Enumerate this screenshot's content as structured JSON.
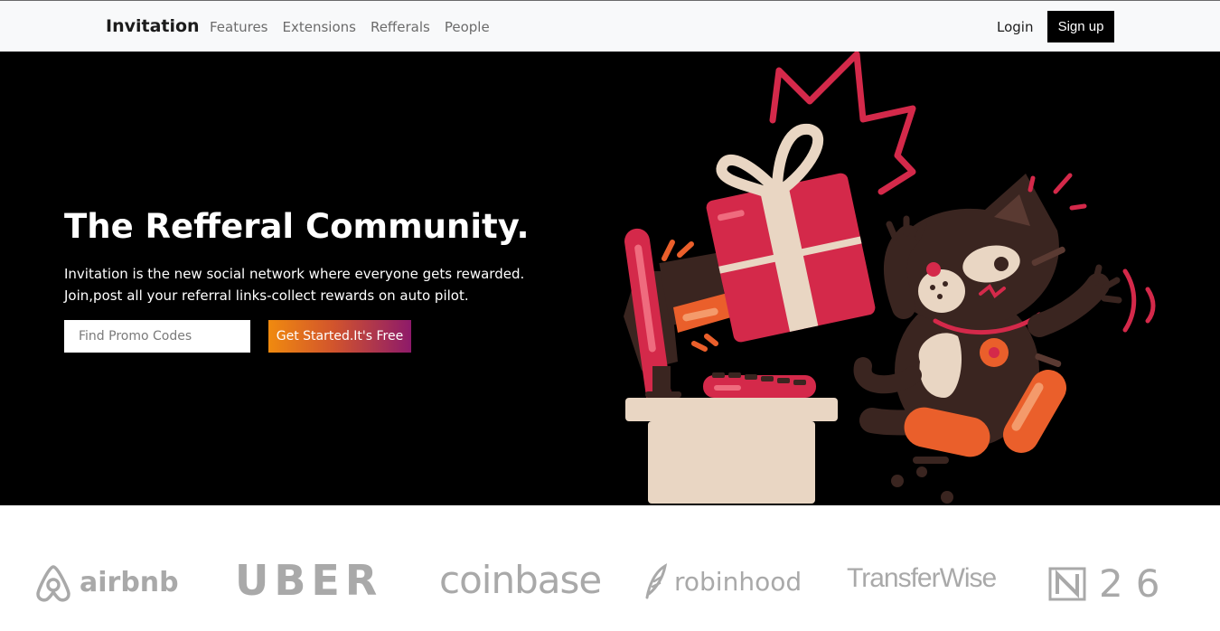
{
  "navbar": {
    "brand": "Invitation",
    "links": [
      "Features",
      "Extensions",
      "Refferals",
      "People"
    ],
    "login": "Login",
    "signup": "Sign up"
  },
  "hero": {
    "title": "The Refferal Community.",
    "lines": [
      "Invitation is the new social network where everyone gets rewarded.",
      "Join,post all your referral links-collect rewards on auto pilot."
    ],
    "search_placeholder": "Find Promo Codes",
    "cta": "Get Started.It's Free"
  },
  "logos": {
    "airbnb": "airbnb",
    "uber": "UBER",
    "coinbase": "coinbase",
    "robinhood": "robinhood",
    "transferwise": "TransferWise",
    "n26_digits": "26"
  },
  "colors": {
    "hero_bg": "#000000",
    "navbar_bg": "#f8f9fa",
    "cta_gradient_start": "#f08a0f",
    "cta_gradient_end": "#8e1a6a",
    "accent_red": "#d4294a",
    "logo_gray": "#a9a9a9"
  }
}
